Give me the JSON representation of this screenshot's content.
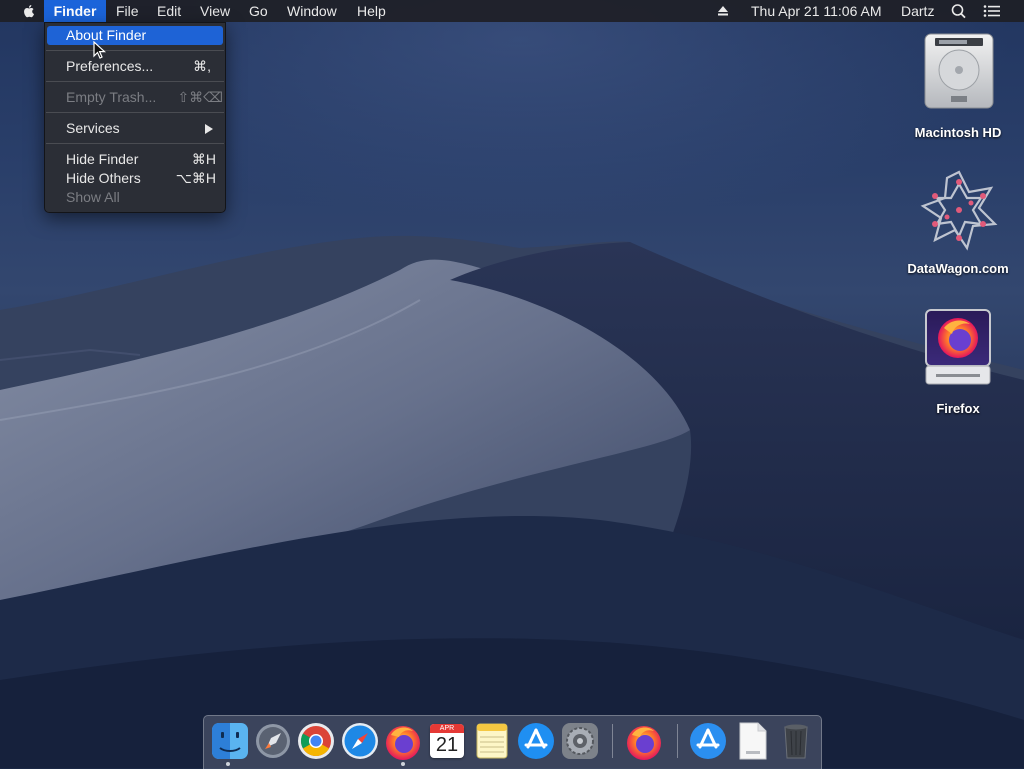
{
  "menubar": {
    "app_name": "Finder",
    "menus": [
      "File",
      "Edit",
      "View",
      "Go",
      "Window",
      "Help"
    ],
    "clock": "Thu Apr 21  11:06 AM",
    "user": "Dartz",
    "icons": [
      "apple-icon",
      "eject-icon",
      "spotlight-search-icon",
      "notification-center-icon"
    ]
  },
  "finder_menu": {
    "about": "About Finder",
    "preferences": "Preferences...",
    "preferences_shortcut": "⌘,",
    "empty_trash": "Empty Trash...",
    "empty_trash_shortcut": "⇧⌘⌫",
    "services": "Services",
    "hide_finder": "Hide Finder",
    "hide_finder_shortcut": "⌘H",
    "hide_others": "Hide Others",
    "hide_others_shortcut": "⌥⌘H",
    "show_all": "Show All"
  },
  "desktop_icons": {
    "hd": "Macintosh HD",
    "datawagon": "DataWagon.com",
    "firefox": "Firefox"
  },
  "dock": {
    "calendar_month": "APR",
    "calendar_day": "21",
    "apps": [
      "Finder",
      "Launchpad",
      "Google Chrome",
      "Safari",
      "Firefox",
      "Calendar",
      "Notes",
      "App Store",
      "System Preferences",
      "Firefox",
      "Applications",
      "Document",
      "Trash"
    ]
  },
  "colors": {
    "menu_highlight": "#1e63d6",
    "menubar_bg": "#1e2026"
  }
}
